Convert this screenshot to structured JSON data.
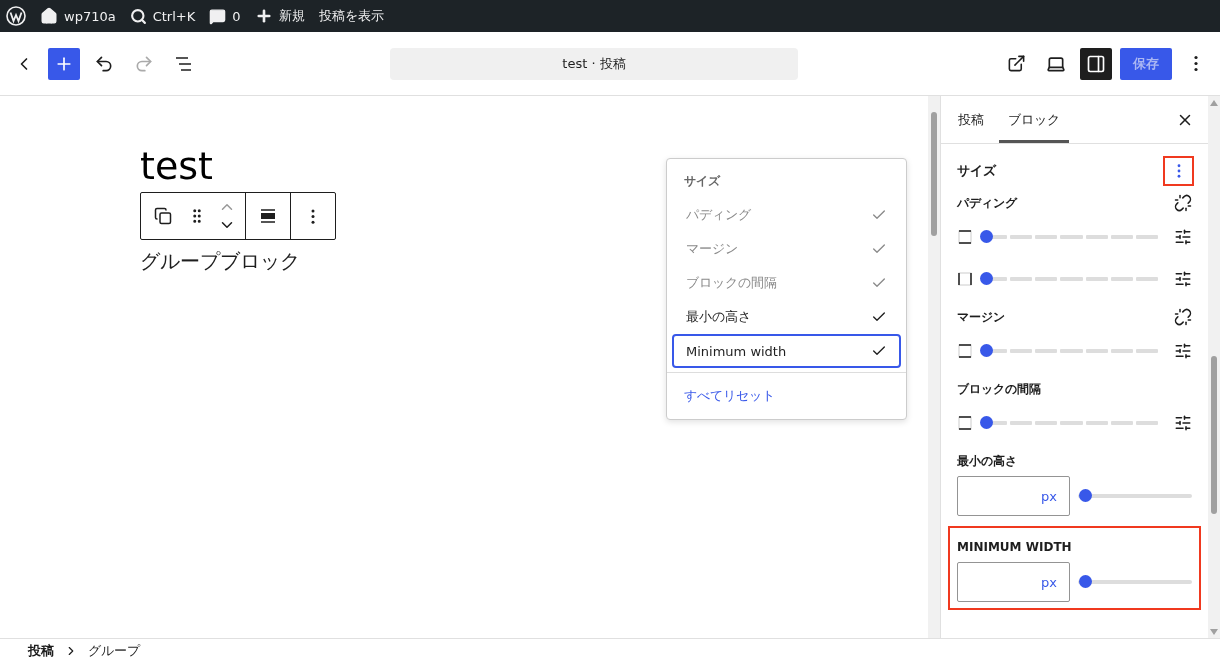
{
  "admin_bar": {
    "items": [
      {
        "kind": "home",
        "label": "wp710a"
      },
      {
        "kind": "search",
        "label": "Ctrl+K"
      },
      {
        "kind": "comments",
        "label": "0"
      },
      {
        "kind": "new",
        "label": "新規"
      },
      {
        "kind": "plain",
        "label": "投稿を表示"
      }
    ]
  },
  "header": {
    "add_pressed": true,
    "redo_disabled": true,
    "document_title": "test · 投稿",
    "sidebar_pressed": true,
    "save": {
      "label": "保存",
      "disabled": true
    }
  },
  "canvas": {
    "title": "test",
    "paragraph": "グループブロック"
  },
  "menu": {
    "title": "サイズ",
    "items": [
      {
        "label": "パディング",
        "checked": true,
        "disabled": true,
        "focused": false
      },
      {
        "label": "マージン",
        "checked": true,
        "disabled": true,
        "focused": false
      },
      {
        "label": "ブロックの間隔",
        "checked": true,
        "disabled": true,
        "focused": false
      },
      {
        "label": "最小の高さ",
        "checked": true,
        "disabled": false,
        "focused": false
      },
      {
        "label": "Minimum width",
        "checked": true,
        "disabled": false,
        "focused": true
      }
    ],
    "reset": "すべてリセット"
  },
  "sidebar": {
    "tabs": [
      {
        "label": "投稿",
        "selected": false
      },
      {
        "label": "ブロック",
        "selected": true
      }
    ],
    "panel": {
      "title": "サイズ",
      "options_highlighted": true,
      "sections": [
        {
          "kind": "spacing",
          "label": "パディング",
          "link_toggle": true,
          "highlighted": false,
          "rows": [
            {
              "kind": "vertical",
              "level": 0
            },
            {
              "kind": "horizontal",
              "level": 0
            }
          ]
        },
        {
          "kind": "spacing",
          "label": "マージン",
          "link_toggle": true,
          "highlighted": false,
          "rows": [
            {
              "kind": "vertical",
              "level": 0
            }
          ]
        },
        {
          "kind": "spacing",
          "label": "ブロックの間隔",
          "link_toggle": false,
          "highlighted": false,
          "rows": [
            {
              "kind": "vertical",
              "level": 0
            }
          ]
        },
        {
          "kind": "unit",
          "label": "最小の高さ",
          "unit": "px",
          "level": 0,
          "highlighted": false
        },
        {
          "kind": "unit",
          "label": "MINIMUM WIDTH",
          "unit": "px",
          "level": 0,
          "highlighted": true
        }
      ]
    }
  },
  "breadcrumb": [
    {
      "label": "投稿",
      "current": false
    },
    {
      "label": "グループ",
      "current": true
    }
  ]
}
